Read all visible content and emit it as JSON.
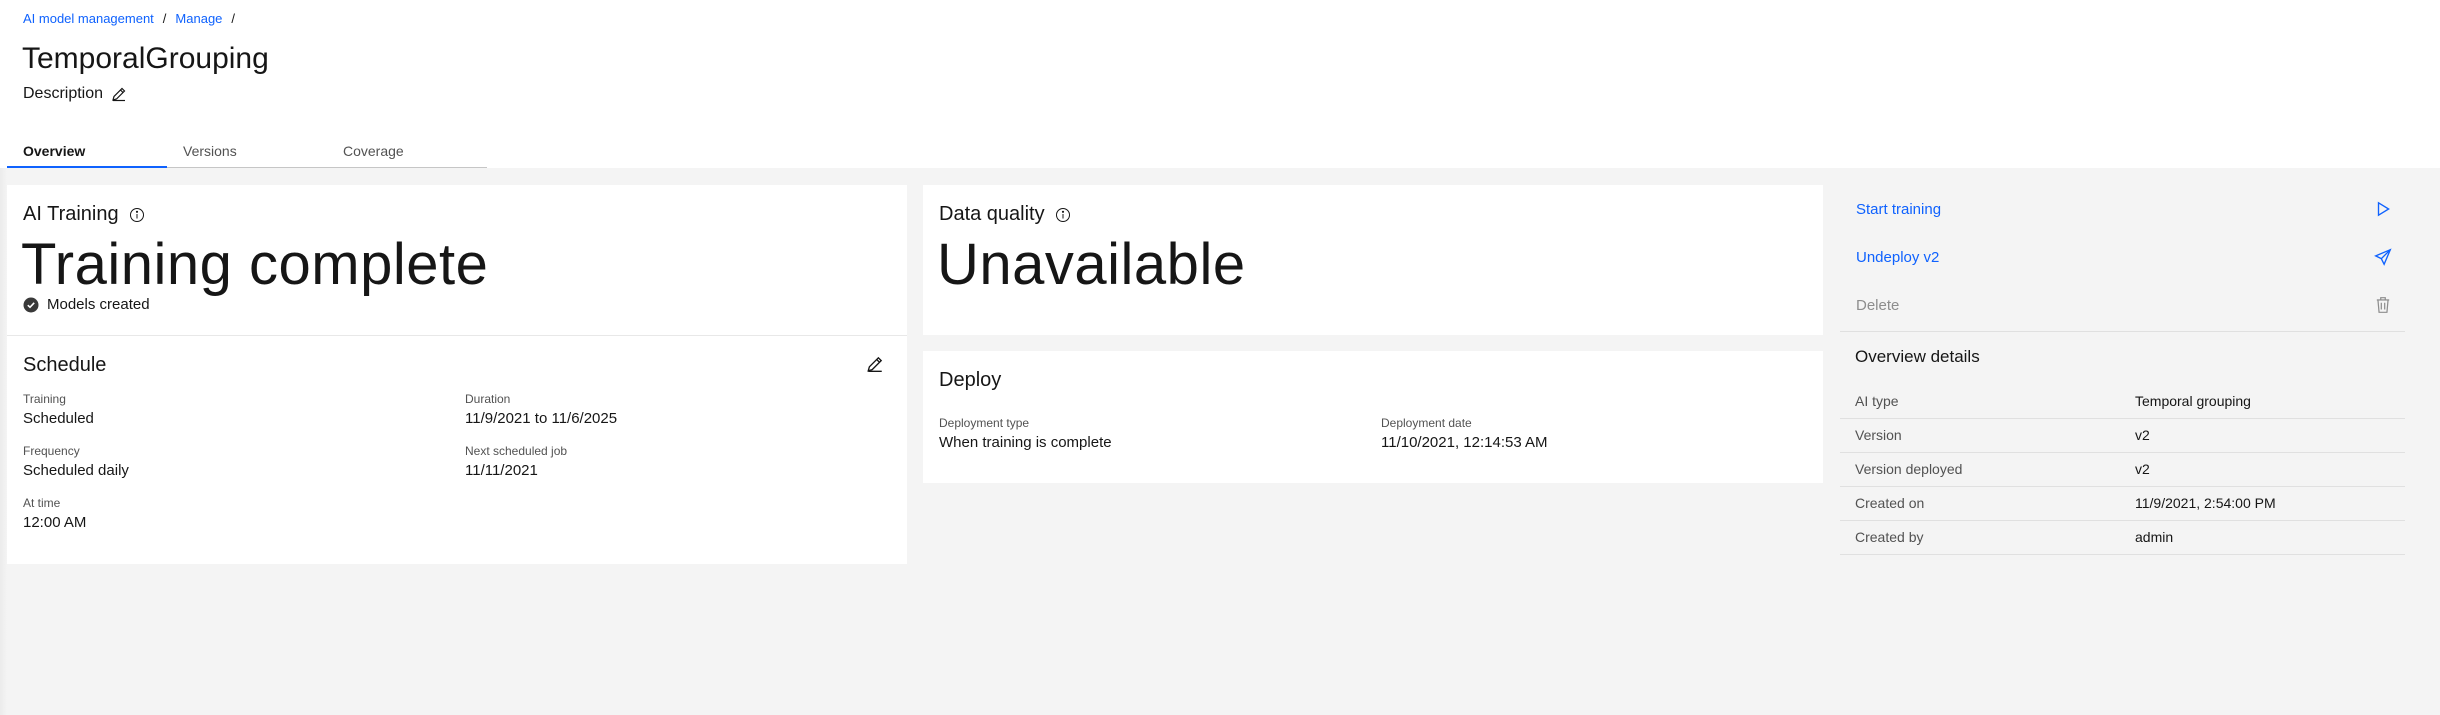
{
  "breadcrumb": {
    "items": [
      "AI model management",
      "Manage"
    ],
    "separator": "/"
  },
  "page": {
    "title": "TemporalGrouping",
    "description_label": "Description"
  },
  "tabs": [
    {
      "label": "Overview",
      "active": true
    },
    {
      "label": "Versions",
      "active": false
    },
    {
      "label": "Coverage",
      "active": false
    }
  ],
  "ai_training": {
    "title": "AI Training",
    "status": "Training complete",
    "sub_status": "Models created"
  },
  "schedule": {
    "title": "Schedule",
    "fields": [
      {
        "label": "Training",
        "value": "Scheduled"
      },
      {
        "label": "Duration",
        "value": "11/9/2021 to 11/6/2025"
      },
      {
        "label": "Frequency",
        "value": "Scheduled daily"
      },
      {
        "label": "Next scheduled job",
        "value": "11/11/2021"
      },
      {
        "label": "At time",
        "value": "12:00 AM"
      }
    ]
  },
  "data_quality": {
    "title": "Data quality",
    "status": "Unavailable"
  },
  "deploy": {
    "title": "Deploy",
    "fields": [
      {
        "label": "Deployment type",
        "value": "When training is complete"
      },
      {
        "label": "Deployment date",
        "value": "11/10/2021, 12:14:53 AM"
      }
    ]
  },
  "actions": [
    {
      "label": "Start training",
      "icon": "play-icon",
      "enabled": true
    },
    {
      "label": "Undeploy v2",
      "icon": "send-icon",
      "enabled": true
    },
    {
      "label": "Delete",
      "icon": "trash-icon",
      "enabled": false
    }
  ],
  "overview_details": {
    "title": "Overview details",
    "rows": [
      {
        "key": "AI type",
        "value": "Temporal grouping"
      },
      {
        "key": "Version",
        "value": "v2"
      },
      {
        "key": "Version deployed",
        "value": "v2"
      },
      {
        "key": "Created on",
        "value": "11/9/2021, 2:54:00 PM"
      },
      {
        "key": "Created by",
        "value": "admin"
      }
    ]
  },
  "colors": {
    "link": "#0f62fe",
    "background": "#f4f4f4",
    "card": "#ffffff",
    "text": "#161616",
    "secondary_text": "#525252",
    "disabled_text": "#8d8d8d"
  }
}
